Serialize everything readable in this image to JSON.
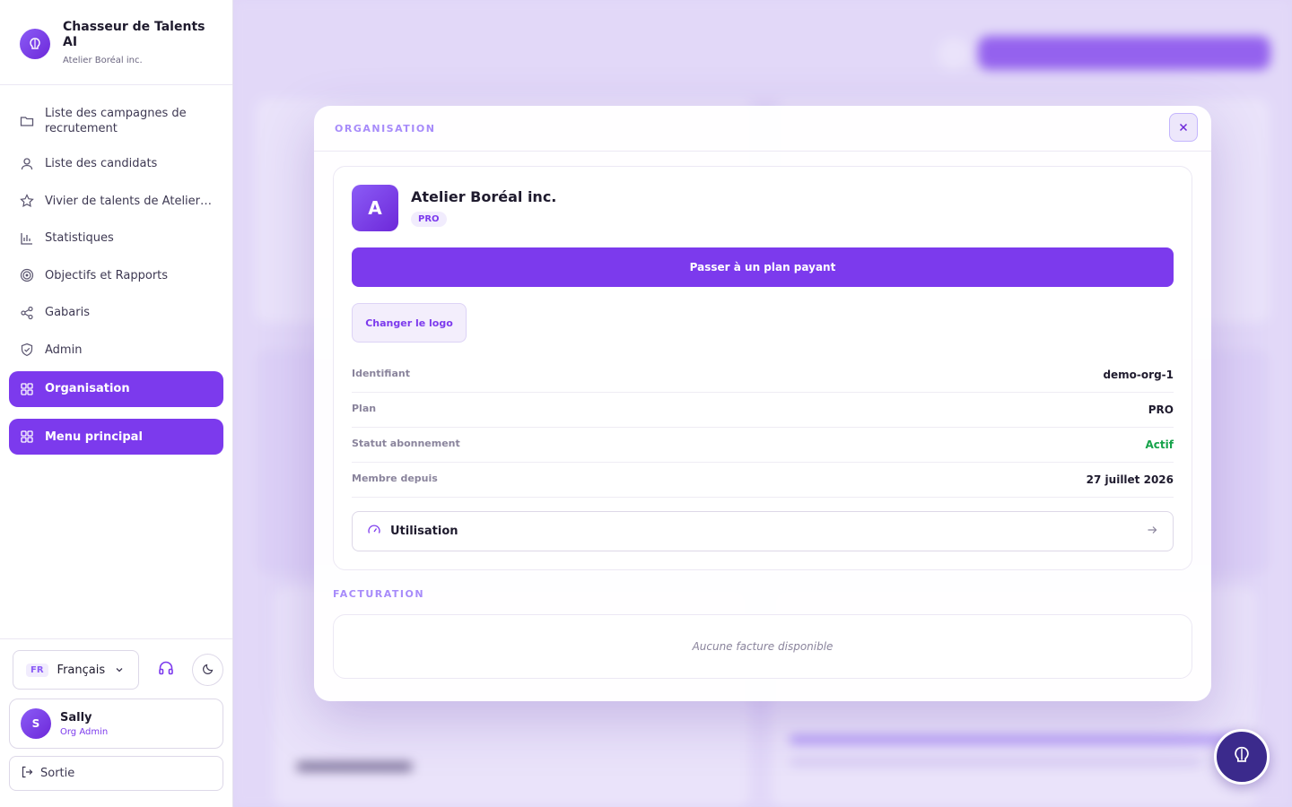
{
  "brand": {
    "title": "Chasseur de Talents AI",
    "org": "Atelier Boréal inc."
  },
  "nav": {
    "items": [
      {
        "label": "Liste des campagnes de recrutement",
        "icon": "folder-icon"
      },
      {
        "label": "Liste des candidats",
        "icon": "user-icon"
      },
      {
        "label": "Vivier de talents de Atelier Boréal inc.",
        "icon": "star-icon"
      },
      {
        "label": "Statistiques",
        "icon": "bar-chart-icon"
      },
      {
        "label": "Objectifs et Rapports",
        "icon": "target-icon"
      },
      {
        "label": "Gabaris",
        "icon": "share-icon"
      },
      {
        "label": "Admin",
        "icon": "shield-icon"
      },
      {
        "label": "Organisation",
        "icon": "grid-icon",
        "active": true
      },
      {
        "label": "Menu principal",
        "icon": "grid-icon",
        "active": true
      }
    ]
  },
  "footer": {
    "lang_code": "FR",
    "lang_name": "Français",
    "user_initial": "S",
    "user_name": "Sally",
    "user_role": "Org Admin",
    "logout": "Sortie"
  },
  "modal": {
    "section_org": "ORGANISATION",
    "org_initial": "A",
    "org_name": "Atelier Boréal inc.",
    "plan_badge": "PRO",
    "upgrade_button": "Passer à un plan payant",
    "change_logo_button": "Changer le logo",
    "info": [
      {
        "key": "Identifiant",
        "value": "demo-org-1"
      },
      {
        "key": "Plan",
        "value": "PRO"
      },
      {
        "key": "Statut abonnement",
        "value": "Actif"
      },
      {
        "key": "Membre depuis",
        "value": "27 juillet 2026"
      }
    ],
    "usage_label": "Utilisation",
    "section_billing": "FACTURATION",
    "billing_empty": "Aucune facture disponible"
  },
  "colors": {
    "accent": "#7c3aed",
    "success": "#16a34a"
  }
}
